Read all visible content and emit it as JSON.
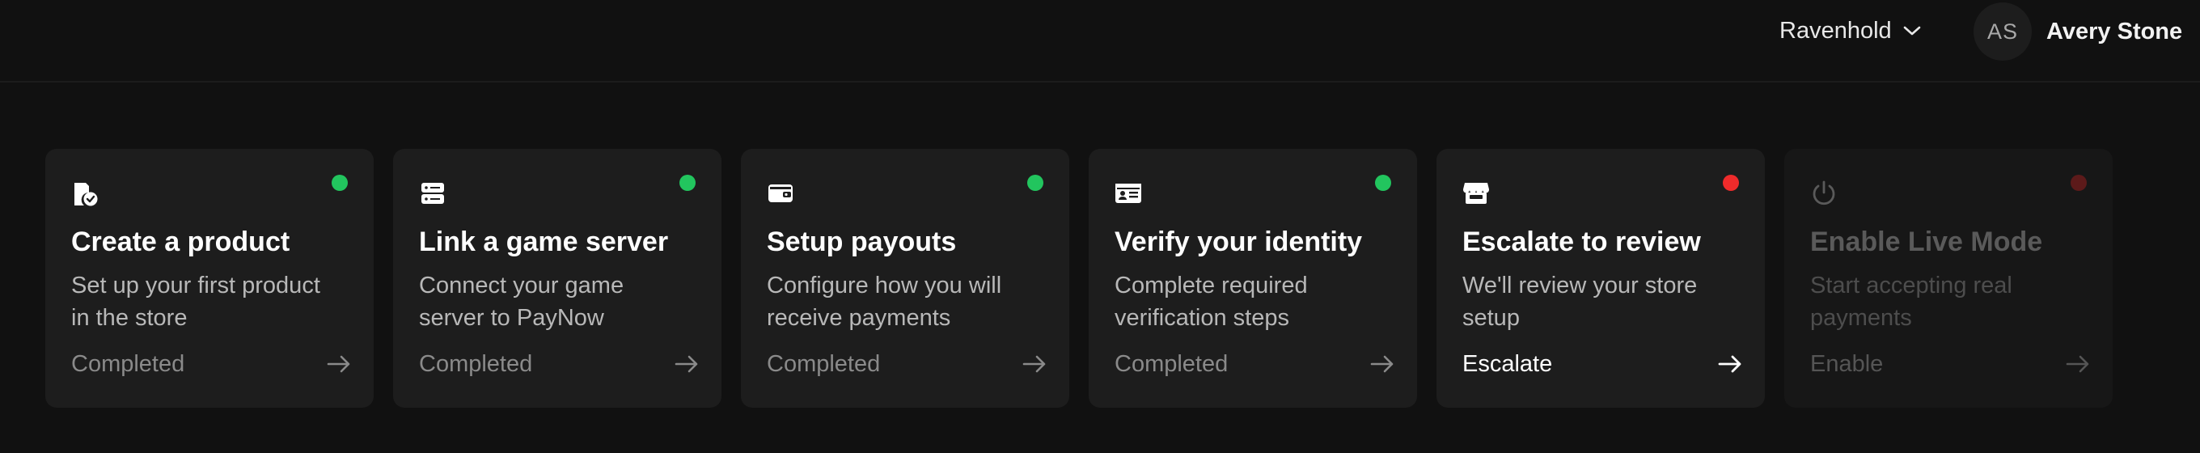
{
  "header": {
    "store_name": "Ravenhold",
    "user_initials": "AS",
    "user_name": "Avery Stone"
  },
  "colors": {
    "dot_green": "#22c55e",
    "dot_red": "#ef2b2b",
    "dot_dim_red": "#5c1a1a"
  },
  "cards": [
    {
      "icon": "product-tag-icon",
      "status": "green",
      "title": "Create a product",
      "description": "Set up your first product in the store",
      "action": "Completed"
    },
    {
      "icon": "server-icon",
      "status": "green",
      "title": "Link a game server",
      "description": "Connect your game server to PayNow",
      "action": "Completed"
    },
    {
      "icon": "wallet-icon",
      "status": "green",
      "title": "Setup payouts",
      "description": "Configure how you will receive payments",
      "action": "Completed"
    },
    {
      "icon": "id-card-icon",
      "status": "green",
      "title": "Verify your identity",
      "description": "Complete required verification steps",
      "action": "Completed"
    },
    {
      "icon": "storefront-icon",
      "status": "red",
      "title": "Escalate to review",
      "description": "We'll review your store setup",
      "action": "Escalate"
    },
    {
      "icon": "power-icon",
      "status": "dim-red",
      "title": "Enable Live Mode",
      "description": "Start accepting real payments",
      "action": "Enable"
    }
  ]
}
